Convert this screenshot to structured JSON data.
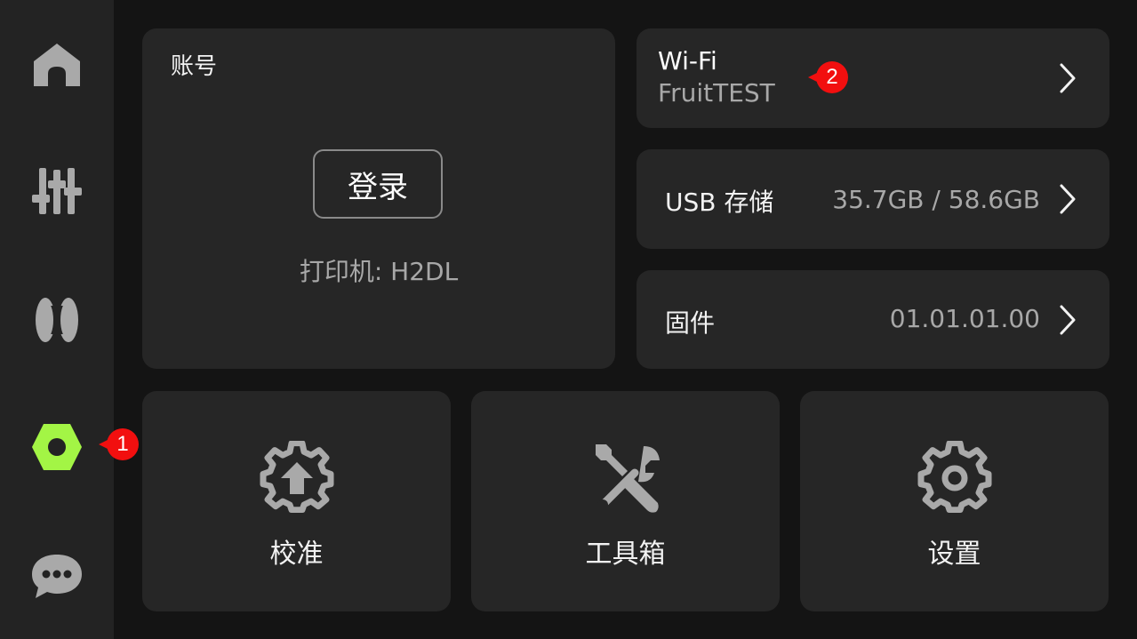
{
  "sidebar": {
    "items": [
      {
        "icon": "home-icon"
      },
      {
        "icon": "controls-sliders-icon"
      },
      {
        "icon": "filament-spools-icon"
      },
      {
        "icon": "hex-nut-icon",
        "active": true,
        "badge": "1"
      },
      {
        "icon": "chat-bubble-icon"
      }
    ],
    "active_color": "#a3f545",
    "inactive_color": "#a9a9a9"
  },
  "account": {
    "title": "账号",
    "login_label": "登录",
    "printer_info": "打印机: H2DL"
  },
  "wifi": {
    "title": "Wi-Fi",
    "ssid": "FruitTEST",
    "badge": "2"
  },
  "usb": {
    "label": "USB 存储",
    "value": "35.7GB / 58.6GB"
  },
  "firmware": {
    "label": "固件",
    "value": "01.01.01.00"
  },
  "tiles": [
    {
      "label": "校准",
      "icon": "calibration-gear-icon"
    },
    {
      "label": "工具箱",
      "icon": "toolbox-wrench-screwdriver-icon"
    },
    {
      "label": "设置",
      "icon": "settings-gear-icon"
    }
  ],
  "colors": {
    "background": "#141414",
    "sidebar": "#232323",
    "card": "#262626",
    "badge": "#f20f0f"
  }
}
